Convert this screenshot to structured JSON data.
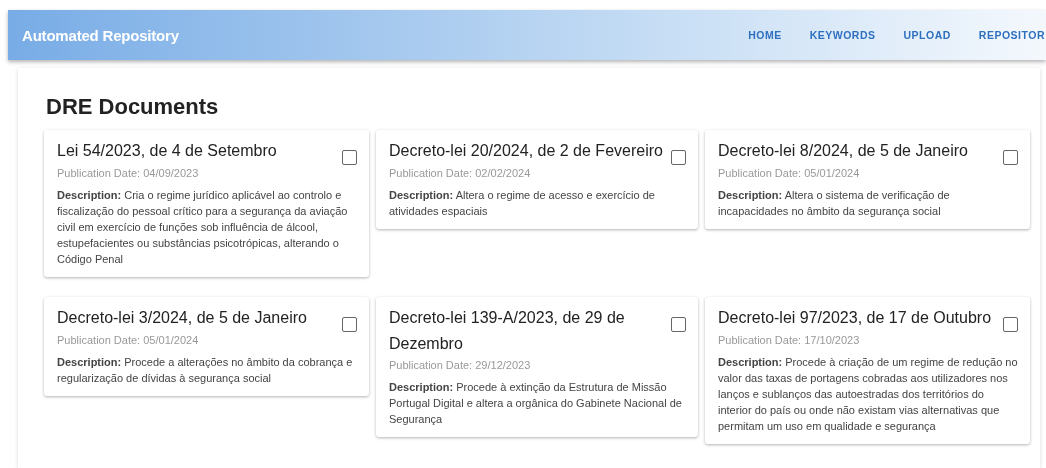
{
  "app_bar": {
    "title": "Automated Repository",
    "nav": [
      {
        "label": "HOME"
      },
      {
        "label": "KEYWORDS"
      },
      {
        "label": "UPLOAD"
      },
      {
        "label": "REPOSITOR"
      }
    ]
  },
  "heading": "DRE Documents",
  "documents": [
    {
      "title": "Lei 54/2023, de 4 de Setembro",
      "date": "Publication Date: 04/09/2023",
      "description": "**Description:** Cria o regime jurídico aplicável ao controlo e fiscalização do pessoal crítico para a segurança da aviação civil em exercício de funções sob influência de álcool, estupefacientes ou substâncias psicotrópicas, alterando o Código Penal",
      "checked": false
    },
    {
      "title": "Decreto-lei 20/2024, de 2 de Fevereiro",
      "date": "Publication Date: 02/02/2024",
      "description": "**Description:** Altera o regime de acesso e exercício de atividades espaciais",
      "checked": false
    },
    {
      "title": "Decreto-lei 8/2024, de 5 de Janeiro",
      "date": "Publication Date: 05/01/2024",
      "description": "**Description:** Altera o sistema de verificação de incapacidades no âmbito da segurança social",
      "checked": false
    },
    {
      "title": "Decreto-lei 3/2024, de 5 de Janeiro",
      "date": "Publication Date: 05/01/2024",
      "description": "**Description:** Procede a alterações no âmbito da cobrança e regularização de dívidas à segurança social",
      "checked": false
    },
    {
      "title": "Decreto-lei 139-A/2023, de 29 de Dezembro",
      "date": "Publication Date: 29/12/2023",
      "description": "**Description:** Procede à extinção da Estrutura de Missão Portugal Digital e altera a orgânica do Gabinete Nacional de Segurança",
      "checked": false
    },
    {
      "title": "Decreto-lei 97/2023, de 17 de Outubro",
      "date": "Publication Date: 17/10/2023",
      "description": "**Description:** Procede à criação de um regime de redução no valor das taxas de portagens cobradas aos utilizadores nos lanços e sublanços das autoestradas dos territórios do interior do país ou onde não existam vias alternativas que permitam um uso em qualidade e segurança",
      "checked": false
    }
  ]
}
